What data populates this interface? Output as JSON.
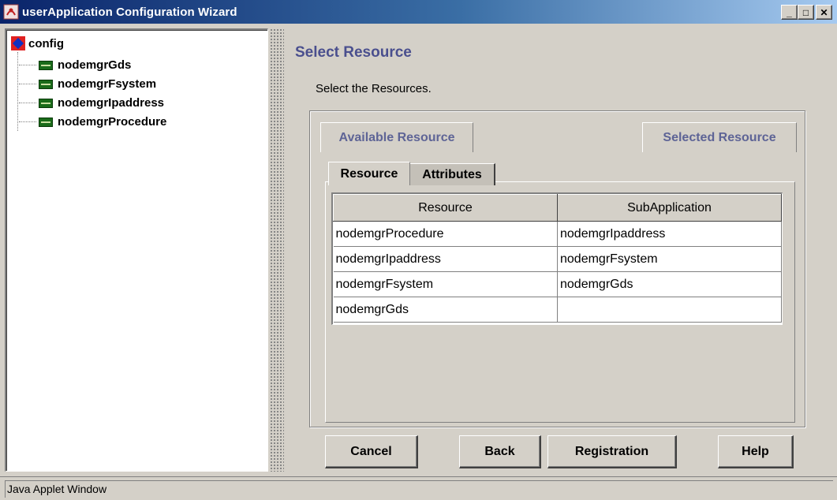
{
  "window": {
    "title": "userApplication Configuration Wizard",
    "minimize": "_",
    "maximize": "□",
    "close": "✕"
  },
  "tree": {
    "root": {
      "label": "config",
      "icon": "config-folder-icon"
    },
    "items": [
      {
        "label": "nodemgrGds",
        "icon": "resource-chip-icon"
      },
      {
        "label": "nodemgrFsystem",
        "icon": "resource-chip-icon"
      },
      {
        "label": "nodemgrIpaddress",
        "icon": "resource-chip-icon"
      },
      {
        "label": "nodemgrProcedure",
        "icon": "resource-chip-icon"
      }
    ]
  },
  "main": {
    "title": "Select Resource",
    "instruction": "Select the Resources.",
    "available_tab": "Available Resource",
    "selected_tab": "Selected Resource",
    "subtabs": [
      "Resource",
      "Attributes"
    ],
    "table": {
      "headers": [
        "Resource",
        "SubApplication"
      ],
      "rows": [
        [
          "nodemgrProcedure",
          "nodemgrIpaddress"
        ],
        [
          "nodemgrIpaddress",
          "nodemgrFsystem"
        ],
        [
          "nodemgrFsystem",
          "nodemgrGds"
        ],
        [
          "nodemgrGds",
          ""
        ]
      ]
    }
  },
  "buttons": {
    "cancel": "Cancel",
    "back": "Back",
    "registration": "Registration",
    "help": "Help"
  },
  "status": "Java Applet Window",
  "colors": {
    "title_gradient_start": "#0a246a",
    "heading": "#4a4f8e",
    "face": "#d4d0c8"
  }
}
